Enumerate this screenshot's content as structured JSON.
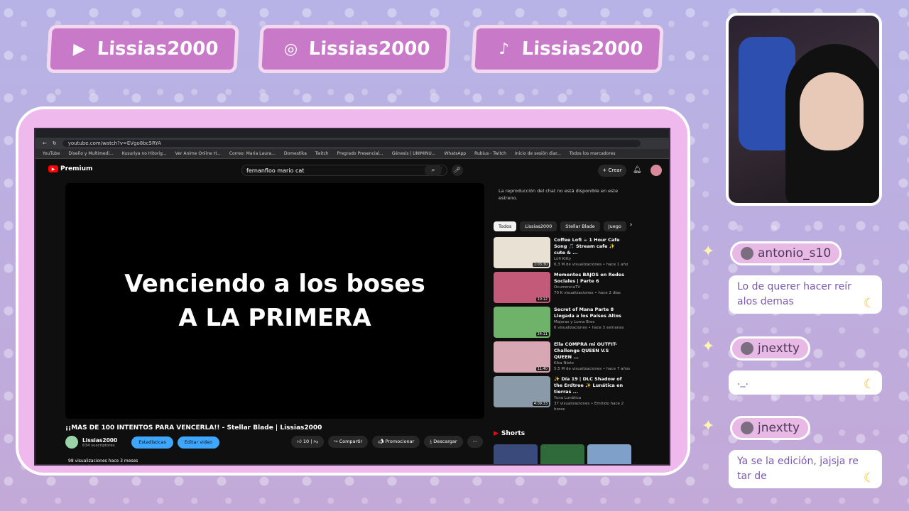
{
  "socials": [
    {
      "icon": "youtube-icon",
      "glyph": "▶",
      "handle": "Lissias2000"
    },
    {
      "icon": "instagram-icon",
      "glyph": "◎",
      "handle": "Lissias2000"
    },
    {
      "icon": "tiktok-icon",
      "glyph": "♪",
      "handle": "Lissias2000"
    }
  ],
  "browser": {
    "url": "youtube.com/watch?v=EVgo8bc5RYA",
    "bookmarks": [
      "YouTube",
      "Diseño y Multimedi...",
      "Kusuriya no Hitorig...",
      "Ver Anime Online H...",
      "Correo: Maria Laura...",
      "Domestika",
      "Twitch",
      "Pregrado Presencial...",
      "Génesis | UNIMINU...",
      "WhatsApp",
      "Rubius - Twitch",
      "Inicio de sesión diar...",
      "Todos los marcadores"
    ]
  },
  "youtube": {
    "logo": "Premium",
    "search_value": "fernanfloo mario cat",
    "create_label": "Crear",
    "player_line1": "Venciendo a los boses",
    "player_line2": "A LA PRIMERA",
    "video_title": "¡¡MAS DE 100 INTENTOS PARA VENCERLA!! - Stellar Blade | Lissias2000",
    "channel_name": "Lissias2000",
    "subscribers": "634 suscriptores",
    "stats_btn": "Estadísticas",
    "edit_btn": "Editar video",
    "likes": "10",
    "share": "Compartir",
    "promote": "Promocionar",
    "download": "Descargar",
    "views": "98 visualizaciones  hace 3 meses",
    "chat_notice": "La reproducción del chat no está disponible en este estreno.",
    "chips": [
      "Todos",
      "Lissias2000",
      "Stellar Blade",
      "Juego"
    ],
    "shorts": "Shorts",
    "recs": [
      {
        "title": "Coffee Lofi ☕ 1 Hour Cafe Song 🎵 Stream cafe ✨ cute & ...",
        "channel": "Lofi Kitty",
        "meta": "6,3 M de visualizaciones • hace 1 año",
        "dur": "1:03:30",
        "color": "#e9e2d4"
      },
      {
        "title": "Momentos BAJOS en Redes Sociales | Parte 6",
        "channel": "OcurrenciaTV",
        "meta": "70 K visualizaciones • hace 2 días",
        "dur": "10:12",
        "color": "#c45a7a"
      },
      {
        "title": "Secret of Mana Parte 8 Llegada a los Países Altos",
        "channel": "Majoras y Luma Bros",
        "meta": "6 visualizaciones • hace 3 semanas",
        "dur": "24:11",
        "color": "#6fb36a"
      },
      {
        "title": "Ella COMPRA mi OUTFIT- Challenge QUEEN V.S QUEEN ...",
        "channel": "Kika Nieto",
        "meta": "5,5 M de visualizaciones • hace 7 años",
        "dur": "11:40",
        "color": "#d7a7b4"
      },
      {
        "title": "✨ Día 19 | DLC Shadow of the Erdtree ✨ Lunática en tierras ...",
        "channel": "Yuna Lunática",
        "meta": "37 visualizaciones • Emitido hace 2 horas",
        "dur": "4:09:33",
        "color": "#8a9aa8"
      }
    ]
  },
  "chat": [
    {
      "user": "antonio_s10",
      "message": "Lo de querer hacer reír alos demas"
    },
    {
      "user": "jnextty",
      "message": "._."
    },
    {
      "user": "jnextty",
      "message": "Ya se la edición, jajsja re tar de"
    }
  ]
}
